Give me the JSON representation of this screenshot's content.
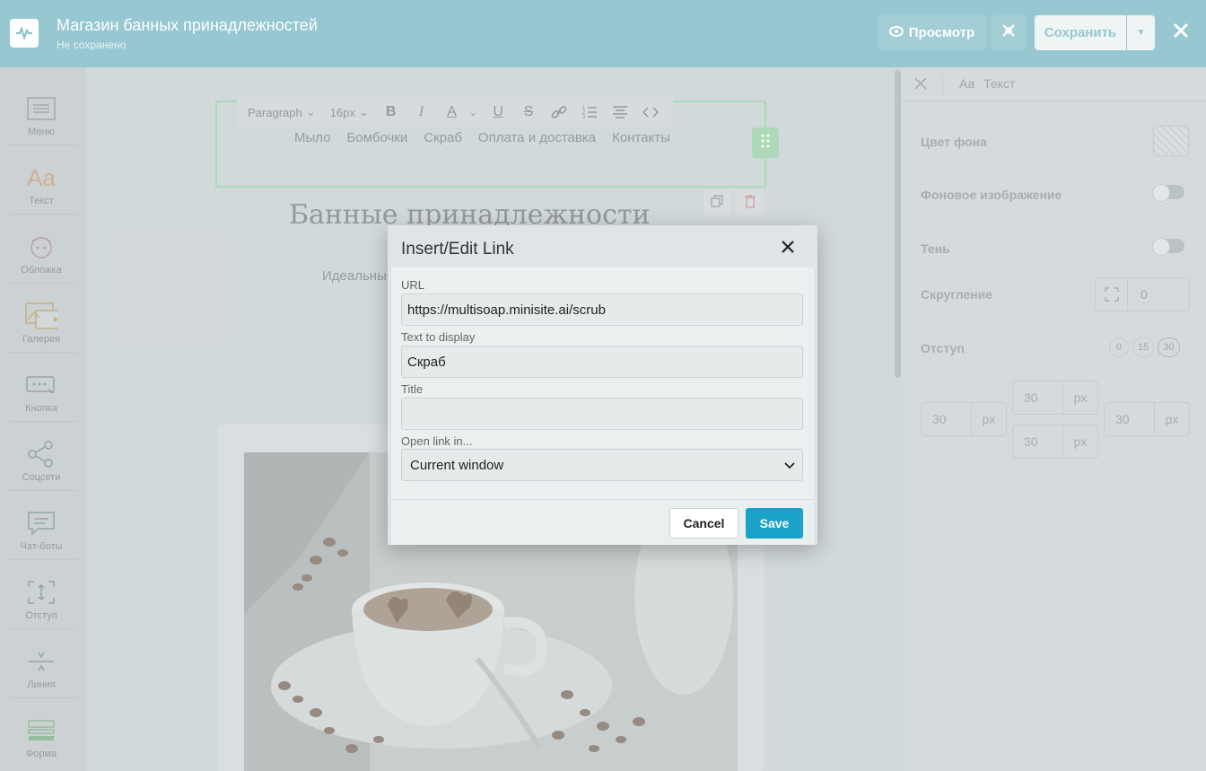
{
  "topbar": {
    "title": "Магазин банных принадлежностей",
    "status": "Не сохранено",
    "preview_label": "Просмотр",
    "save_label": "Сохранить"
  },
  "sidebar": {
    "items": [
      {
        "label": "Меню",
        "icon": "menu-icon"
      },
      {
        "label": "Текст",
        "icon": "text-icon"
      },
      {
        "label": "Обложка",
        "icon": "cover-icon"
      },
      {
        "label": "Галерея",
        "icon": "gallery-icon"
      },
      {
        "label": "Кнопка",
        "icon": "button-icon"
      },
      {
        "label": "Соцсети",
        "icon": "share-icon"
      },
      {
        "label": "Чат-боты",
        "icon": "chat-icon"
      },
      {
        "label": "Отступ",
        "icon": "spacing-icon"
      },
      {
        "label": "Линия",
        "icon": "line-icon"
      },
      {
        "label": "Форма",
        "icon": "form-icon"
      }
    ]
  },
  "editor_toolbar": {
    "format": "Paragraph",
    "size": "16px"
  },
  "page": {
    "menu_items": [
      "Мыло",
      "Бомбочки",
      "Скраб",
      "Оплата и доставка",
      "Контакты"
    ],
    "heading": "Банные принадлежности",
    "subtext": "Идеальны"
  },
  "right_panel": {
    "tab_text_prefix": "Aa",
    "tab_text": "Текст",
    "bg_color_label": "Цвет фона",
    "bg_image_label": "Фоновое изображение",
    "shadow_label": "Тень",
    "radius_label": "Скругление",
    "radius_value": "0",
    "padding_label": "Отступ",
    "padding_presets": [
      "0",
      "15",
      "30"
    ],
    "padding": {
      "top": "30",
      "right": "30",
      "bottom": "30",
      "left": "30",
      "unit": "px"
    }
  },
  "dialog": {
    "title": "Insert/Edit Link",
    "url_label": "URL",
    "url_value": "https://multisoap.minisite.ai/scrub",
    "text_label": "Text to display",
    "text_value": "Скраб",
    "title_label": "Title",
    "title_value": "",
    "target_label": "Open link in...",
    "target_value": "Current window",
    "cancel_label": "Cancel",
    "save_label": "Save"
  },
  "colors": {
    "topbar": "#8fc3cd",
    "accent_save": "#1aa2c8",
    "selection_border": "#a8d6b4"
  }
}
